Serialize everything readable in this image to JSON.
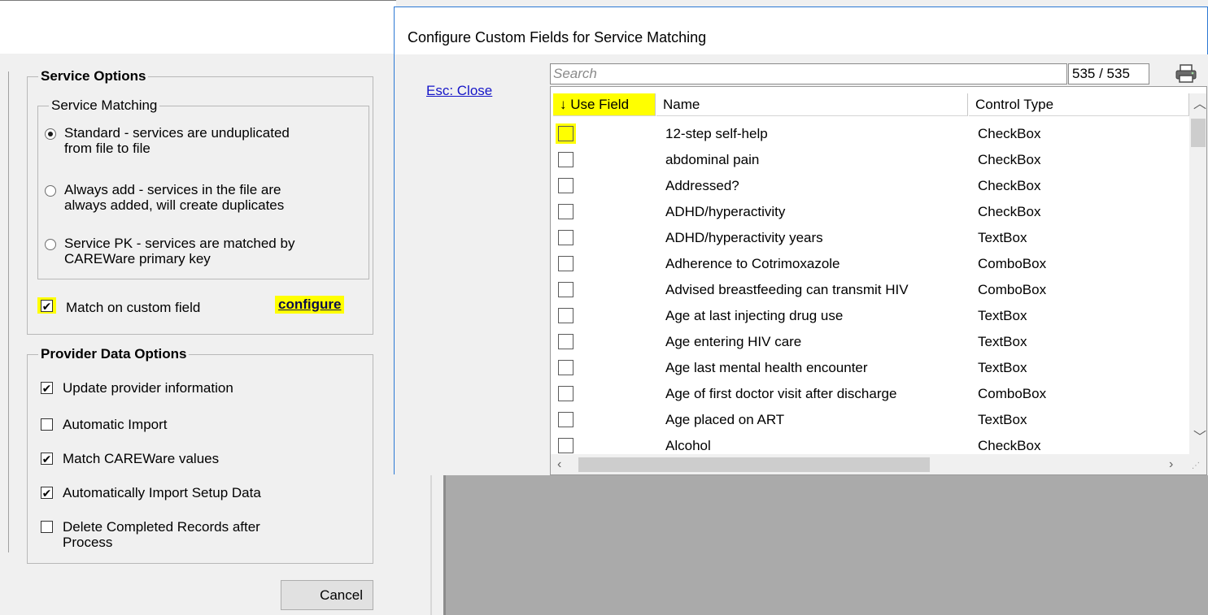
{
  "service_options": {
    "title": "Service Options",
    "matching_title": "Service Matching",
    "options": [
      {
        "line1": "Standard - services are unduplicated",
        "line2": "from file to file",
        "selected": true
      },
      {
        "line1": "Always add - services in the file are",
        "line2": "always added, will create duplicates",
        "selected": false
      },
      {
        "line1": "Service PK - services are matched by",
        "line2": "CAREWare primary key",
        "selected": false
      }
    ],
    "match_custom_label": "Match on custom field",
    "match_custom_checked": true,
    "configure_label": "configure"
  },
  "provider_options": {
    "title": "Provider Data Options",
    "items": [
      {
        "label": "Update provider information",
        "checked": true
      },
      {
        "label": "Automatic Import",
        "checked": false
      },
      {
        "label": "Match CAREWare values",
        "checked": true
      },
      {
        "label": "Automatically Import Setup Data",
        "checked": true
      },
      {
        "label": "Delete Completed Records after",
        "label2": "Process",
        "checked": false
      }
    ]
  },
  "cancel_label": "Cancel",
  "dialog": {
    "title": "Configure Custom Fields for Service Matching",
    "esc_close": "Esc: Close",
    "search_placeholder": "Search",
    "count": "535 / 535",
    "columns": {
      "use": "↓ Use Field",
      "name": "Name",
      "type": "Control Type"
    },
    "rows": [
      {
        "name": "12-step self-help",
        "type": "CheckBox"
      },
      {
        "name": "abdominal pain",
        "type": "CheckBox"
      },
      {
        "name": "Addressed?",
        "type": "CheckBox"
      },
      {
        "name": "ADHD/hyperactivity",
        "type": "CheckBox"
      },
      {
        "name": "ADHD/hyperactivity years",
        "type": "TextBox"
      },
      {
        "name": "Adherence to Cotrimoxazole",
        "type": "ComboBox"
      },
      {
        "name": "Advised breastfeeding can transmit HIV",
        "type": "ComboBox"
      },
      {
        "name": "Age at last injecting drug use",
        "type": "TextBox"
      },
      {
        "name": "Age entering HIV care",
        "type": "TextBox"
      },
      {
        "name": "Age last mental health encounter",
        "type": "TextBox"
      },
      {
        "name": "Age of first doctor visit after discharge",
        "type": "ComboBox"
      },
      {
        "name": "Age placed on ART",
        "type": "TextBox"
      },
      {
        "name": "Alcohol",
        "type": "CheckBox"
      }
    ]
  },
  "colors": {
    "highlight": "#ffff00",
    "link": "#1515c8",
    "dialog_border": "#2b78d4"
  },
  "icons": {
    "print": "printer-icon"
  }
}
